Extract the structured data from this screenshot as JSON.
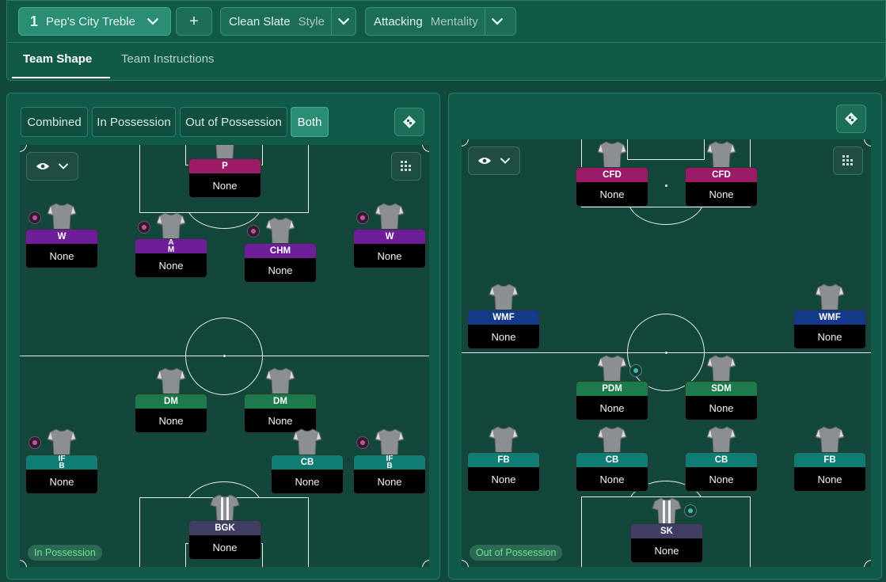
{
  "toolbar": {
    "tactic_number": "1",
    "tactic_name": "Pep's City Treble",
    "add_label": "+",
    "style_value": "Clean Slate",
    "style_label": "Style",
    "mentality_value": "Attacking",
    "mentality_label": "Mentality"
  },
  "tabs": {
    "team_shape": "Team Shape",
    "team_instructions": "Team Instructions"
  },
  "left_panel": {
    "segments": [
      "Combined",
      "In Possession",
      "Out of Possession",
      "Both"
    ],
    "active_segment": "Both",
    "phase_label": "In Possession",
    "players": [
      {
        "role": "P",
        "name": "None"
      },
      {
        "role": "W",
        "name": "None"
      },
      {
        "role": "A\nM",
        "name": "None"
      },
      {
        "role": "CHM",
        "name": "None"
      },
      {
        "role": "W",
        "name": "None"
      },
      {
        "role": "DM",
        "name": "None"
      },
      {
        "role": "DM",
        "name": "None"
      },
      {
        "role": "IF\nB",
        "name": "None"
      },
      {
        "role": "CB",
        "name": "None"
      },
      {
        "role": "IF\nB",
        "name": "None"
      },
      {
        "role": "BGK",
        "name": "None"
      }
    ]
  },
  "right_panel": {
    "phase_label": "Out of Possession",
    "players": [
      {
        "role": "CFD",
        "name": "None"
      },
      {
        "role": "CFD",
        "name": "None"
      },
      {
        "role": "WMF",
        "name": "None"
      },
      {
        "role": "WMF",
        "name": "None"
      },
      {
        "role": "PDM",
        "name": "None"
      },
      {
        "role": "SDM",
        "name": "None"
      },
      {
        "role": "FB",
        "name": "None"
      },
      {
        "role": "CB",
        "name": "None"
      },
      {
        "role": "CB",
        "name": "None"
      },
      {
        "role": "FB",
        "name": "None"
      },
      {
        "role": "SK",
        "name": "None"
      }
    ]
  },
  "icons": {
    "chevron": "chevron-down-icon",
    "tactics_board": "tactics-board-icon",
    "eye": "eye-icon",
    "grid": "grid-icon",
    "shirt": "shirt-icon",
    "instruction": "player-instruction-icon"
  },
  "colors": {
    "pink": "#9c1b66",
    "purple": "#6e1e96",
    "green": "#1d7a4a",
    "teal": "#0f7d73",
    "slate": "#3e3f62",
    "blue": "#143a8a"
  }
}
